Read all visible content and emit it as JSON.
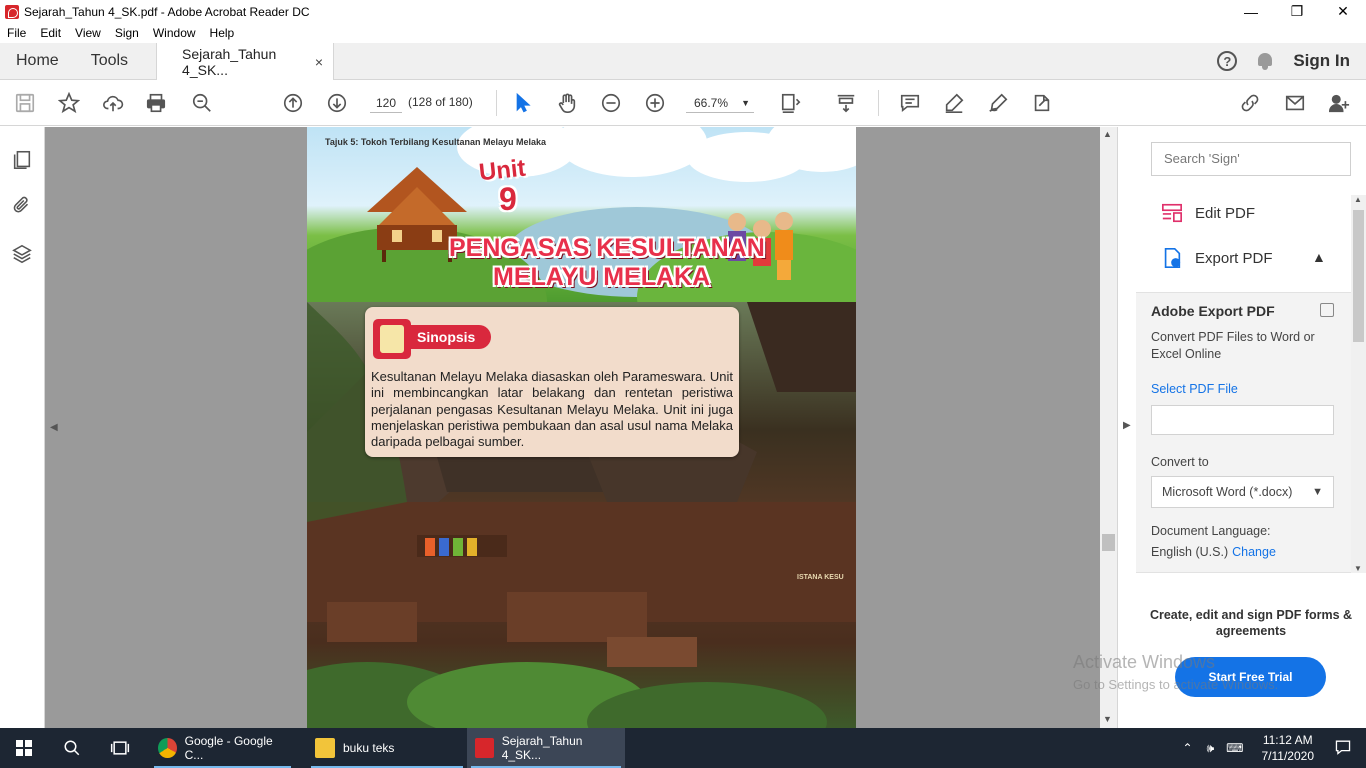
{
  "titlebar": {
    "title": "Sejarah_Tahun 4_SK.pdf - Adobe Acrobat Reader DC",
    "minimize": "—",
    "maximize": "❐",
    "close": "✕"
  },
  "menu": [
    "File",
    "Edit",
    "View",
    "Sign",
    "Window",
    "Help"
  ],
  "tabs": {
    "home": "Home",
    "tools": "Tools",
    "doc": "Sejarah_Tahun 4_SK...",
    "close": "×",
    "help": "?",
    "signin": "Sign In"
  },
  "toolbar": {
    "page_current": "120",
    "page_of": "(128 of 180)",
    "zoom": "66.7%",
    "zoom_arrow": "▼"
  },
  "pdf": {
    "tajuk": "Tajuk 5: Tokoh Terbilang Kesultanan Melayu Melaka",
    "unit_word": "Unit",
    "unit_number": "9",
    "title_line1": "PENGASAS KESULTANAN",
    "title_line2": "MELAYU MELAKA",
    "synopsis_label": "Sinopsis",
    "synopsis_text": "Kesultanan Melayu Melaka diasaskan oleh Parameswara. Unit ini membincangkan latar belakang dan rentetan peristiwa perjalanan pengasas Kesultanan Melayu Melaka. Unit ini juga menjelaskan peristiwa pembukaan dan asal usul nama Melaka daripada pelbagai sumber.",
    "photo_sign": "ISTANA KESU"
  },
  "rightpanel": {
    "search_placeholder": "Search 'Sign'",
    "edit_pdf": "Edit PDF",
    "export_pdf": "Export PDF",
    "section_title": "Adobe Export PDF",
    "section_desc": "Convert PDF Files to Word or Excel Online",
    "select_file": "Select PDF File",
    "convert_to": "Convert to",
    "convert_value": "Microsoft Word (*.docx)",
    "doc_language": "Document Language:",
    "language_value": "English (U.S.)",
    "change": "Change",
    "promo": "Create, edit and sign PDF forms & agreements",
    "trial": "Start Free Trial"
  },
  "watermark": {
    "line1": "Activate Windows",
    "line2": "Go to Settings to activate Windows."
  },
  "taskbar": {
    "apps": [
      {
        "label": "Google - Google C..."
      },
      {
        "label": "buku teks"
      },
      {
        "label": "Sejarah_Tahun 4_SK..."
      }
    ],
    "time": "11:12 AM",
    "date": "7/11/2020"
  },
  "colors": {
    "accent": "#1473e6",
    "taskbar": "#1d2633",
    "unit_red": "#d9283d"
  }
}
